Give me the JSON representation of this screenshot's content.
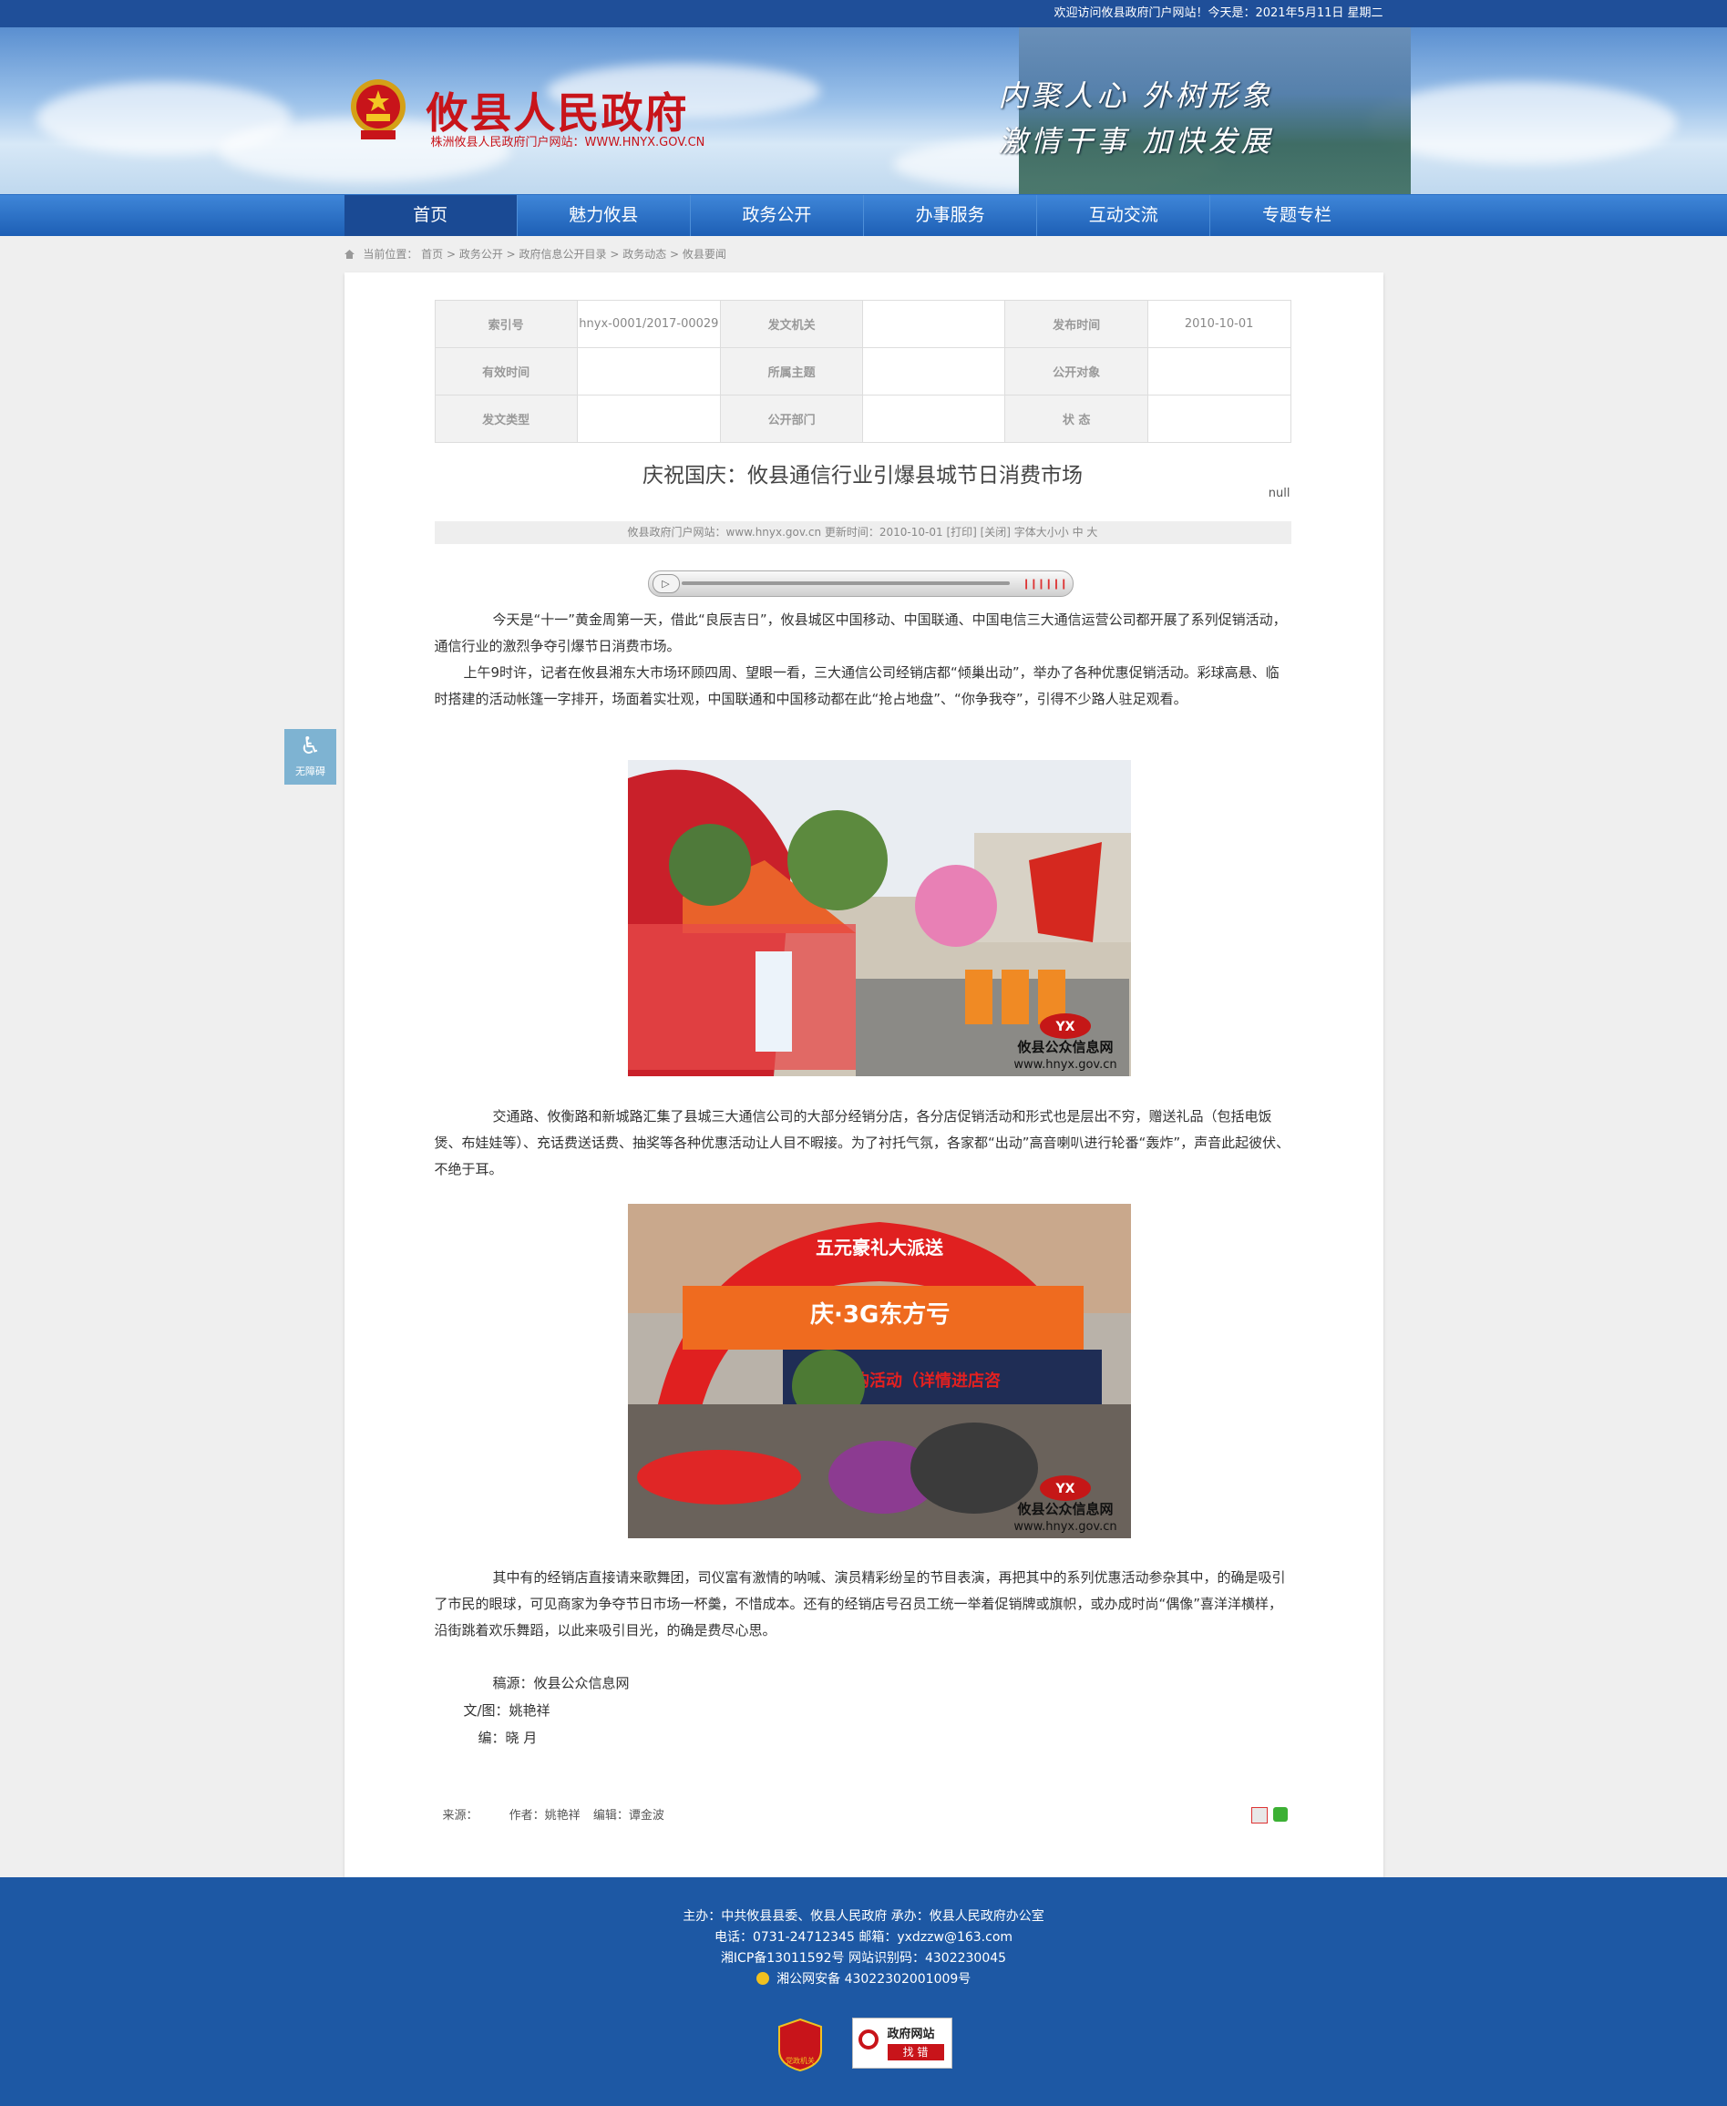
{
  "topbar": {
    "welcome": "欢迎访问攸县政府门户网站！今天是：2021年5月11日 星期二"
  },
  "header": {
    "title": "攸县人民政府",
    "subtitle": "株洲攸县人民政府门户网站：WWW.HNYX.GOV.CN",
    "slogan_line1": "内聚人心  外树形象",
    "slogan_line2": "激情干事  加快发展"
  },
  "nav": {
    "items": [
      "首页",
      "魅力攸县",
      "政务公开",
      "办事服务",
      "互动交流",
      "专题专栏"
    ]
  },
  "breadcrumb": {
    "prefix": "当前位置：",
    "path": "首页 > 政务公开 > 政府信息公开目录 > 政务动态 > 攸县要闻"
  },
  "meta": {
    "index_label": "索引号",
    "index_value": "hnyx-0001/2017-00029",
    "issuer_label": "发文机关",
    "issuer_value": "",
    "date_label": "发布时间",
    "date_value": "2010-10-01",
    "valid_label": "有效时间",
    "valid_value": "",
    "topic_label": "所属主题",
    "topic_value": "",
    "audience_label": "公开对象",
    "audience_value": "",
    "doctype_label": "发文类型",
    "doctype_value": "",
    "dept_label": "公开部门",
    "dept_value": "",
    "status_label": "状 态",
    "status_value": ""
  },
  "article": {
    "title": "庆祝国庆：攸县通信行业引爆县城节日消费市场",
    "null_text": "null",
    "infobar": "攸县政府门户网站：www.hnyx.gov.cn  更新时间：2010-10-01  [打印] [关闭]  字体大小小 中 大",
    "p1": "今天是“十一”黄金周第一天，借此“良辰吉日”，攸县城区中国移动、中国联通、中国电信三大通信运营公司都开展了系列促销活动，通信行业的激烈争夺引爆节日消费市场。",
    "p2": "上午9时许，记者在攸县湘东大市场环顾四周、望眼一看，三大通信公司经销店都“倾巢出动”，举办了各种优惠促销活动。彩球高悬、临时搭建的活动帐篷一字排开，场面着实壮观，中国联通和中国移动都在此“抢占地盘”、“你争我夺”，引得不少路人驻足观看。",
    "p3": "交通路、攸衡路和新城路汇集了县城三大通信公司的大部分经销分店，各分店促销活动和形式也是层出不穷，赠送礼品（包括电饭煲、布娃娃等）、充话费送话费、抽奖等各种优惠活动让人目不暇接。为了衬托气氛，各家都“出动”高音喇叭进行轮番“轰炸”，声音此起彼伏、不绝于耳。",
    "p4": "其中有的经销店直接请来歌舞团，司仪富有激情的呐喊、演员精彩纷呈的节目表演，再把其中的系列优惠活动参杂其中，的确是吸引了市民的眼球，可见商家为争夺节日市场一杯羹，不惜成本。还有的经销店号召员工统一举着促销牌或旗帜，或办成时尚“偶像”喜洋洋横样，沿街跳着欢乐舞蹈，以此来吸引目光，的确是费尽心思。",
    "photo_watermark_name": "攸县公众信息网",
    "photo_watermark_url": "www.hnyx.gov.cn",
    "photo2_banner": "庆·3G东方亏",
    "photo2_scroll": "大抢购活动（详情进店咨",
    "photo2_arch": "五元豪礼大派送",
    "sig_source": "稿源：攸县公众信息网",
    "sig_author": "文/图：姚艳祥",
    "sig_editor": "编：晓   月",
    "footer_source": "来源：",
    "footer_author": "作者：姚艳祥",
    "footer_editor": "编辑：谭金波"
  },
  "accessibility": {
    "label": "无障碍"
  },
  "footer": {
    "line1": "主办：中共攸县县委、攸县人民政府 承办：攸县人民政府办公室",
    "line2": "电话：0731-24712345 邮箱：yxdzzw@163.com",
    "line3": "湘ICP备13011592号   网站识别码：4302230045",
    "line4": "湘公网安备 43022302001009号",
    "badge1_text": "党政机关",
    "badge2_text1": "政府网站",
    "badge2_text2": "找 错"
  }
}
